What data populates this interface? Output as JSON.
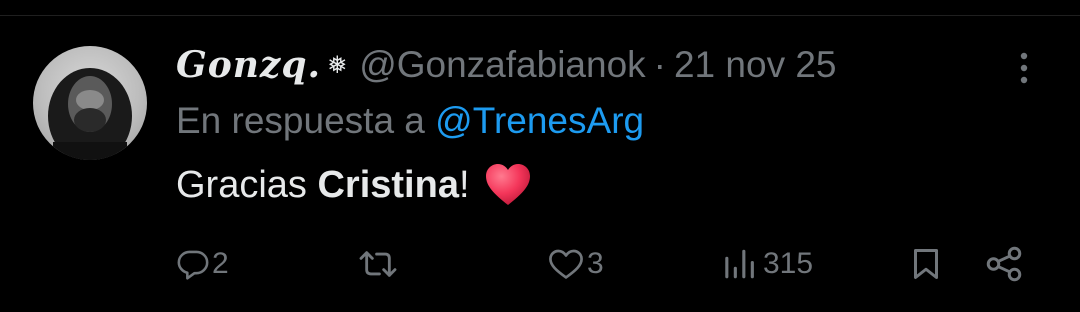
{
  "tweet": {
    "author": {
      "display_name": "Gonzq.",
      "badge_glyph": "❅",
      "handle": "@Gonzafabianok",
      "avatar_icon": "profile-photo"
    },
    "separator": "·",
    "date": "21 nov 25",
    "reply_prefix": "En respuesta a",
    "reply_to": "@TrenesArg",
    "text_part1": "Gracias ",
    "text_bold": "Cristina",
    "text_part2": "!",
    "emoji": "red-heart",
    "actions": {
      "replies": "2",
      "retweets": "",
      "likes": "3",
      "views": "315"
    }
  },
  "colors": {
    "background": "#000000",
    "primary_text": "#e7e9ea",
    "secondary_text": "#71767b",
    "link": "#1d9bf0",
    "heart": "#f4365a"
  }
}
